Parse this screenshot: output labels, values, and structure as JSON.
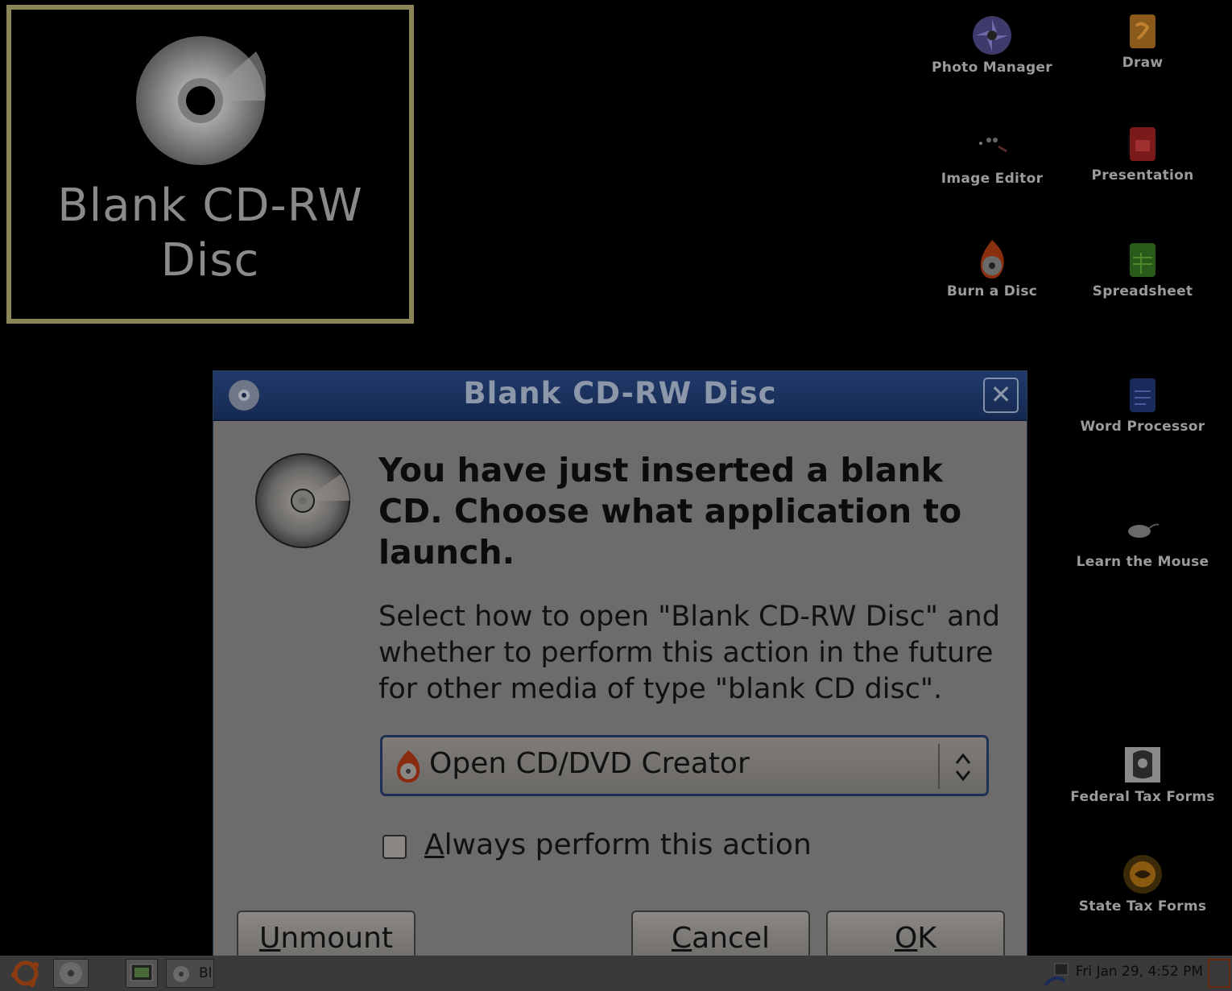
{
  "selected_icon": {
    "label": "Blank CD-RW Disc"
  },
  "desktop_icons": [
    {
      "label": "Photo Manager",
      "icon": "photo-manager-icon"
    },
    {
      "label": "Draw",
      "icon": "draw-icon"
    },
    {
      "label": "Image Editor",
      "icon": "image-editor-icon"
    },
    {
      "label": "Presentation",
      "icon": "presentation-icon"
    },
    {
      "label": "Burn a Disc",
      "icon": "burn-disc-icon"
    },
    {
      "label": "Spreadsheet",
      "icon": "spreadsheet-icon"
    },
    {
      "label": "Word Processor",
      "icon": "word-processor-icon"
    },
    {
      "label": "Learn the Mouse",
      "icon": "mouse-icon"
    },
    {
      "label": "Federal Tax Forms",
      "icon": "federal-tax-icon"
    },
    {
      "label": "State Tax Forms",
      "icon": "state-tax-icon"
    }
  ],
  "dialog": {
    "title": "Blank CD-RW Disc",
    "heading": "You have just inserted a blank CD. Choose what application to launch.",
    "description": "Select how to open \"Blank CD-RW Disc\" and whether to perform this action in the future for other media of type \"blank CD disc\".",
    "combo_value": "Open CD/DVD Creator",
    "checkbox_label_first": "A",
    "checkbox_label_rest": "lways perform this action",
    "checkbox_checked": false,
    "buttons": {
      "unmount_u": "U",
      "unmount_rest": "nmount",
      "cancel_u": "C",
      "cancel_rest": "ancel",
      "ok_u": "O",
      "ok_rest": "K"
    }
  },
  "taskbar": {
    "window_label": "Bl",
    "clock": "Fri Jan 29,  4:52 PM"
  },
  "colors": {
    "dialog_bg": "#6e6c6a",
    "titlebar": "#1b3160",
    "selection_border": "#8a8458"
  }
}
